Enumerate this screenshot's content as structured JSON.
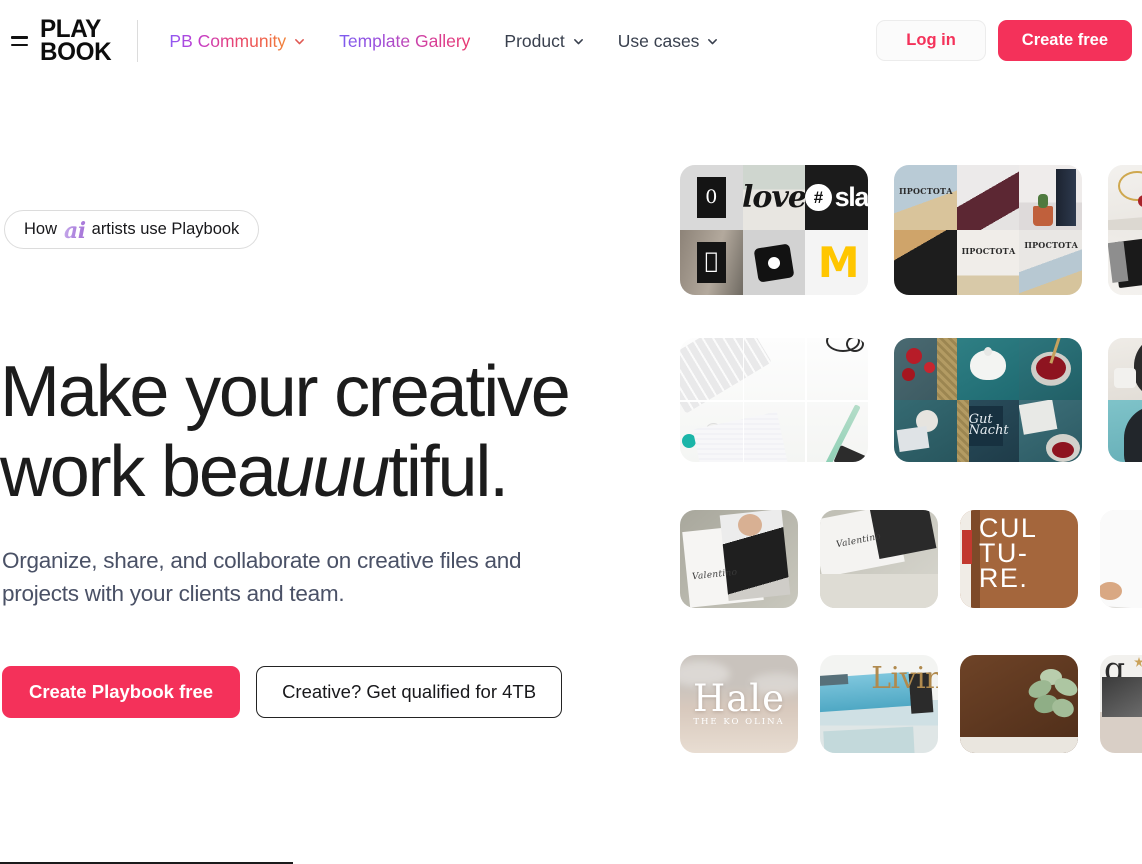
{
  "header": {
    "menu_icon": "hamburger-icon",
    "logo": {
      "line1": "PLAY",
      "line2": "BOOK"
    },
    "nav": [
      {
        "label": "PB Community",
        "style": "gradient-community",
        "has_chevron": true
      },
      {
        "label": "Template Gallery",
        "style": "gradient-template",
        "has_chevron": false
      },
      {
        "label": "Product",
        "style": "plain",
        "has_chevron": true
      },
      {
        "label": "Use cases",
        "style": "plain",
        "has_chevron": true
      }
    ],
    "login_label": "Log in",
    "create_free_label": "Create free"
  },
  "hero": {
    "badge": {
      "before": "How",
      "highlight": "ai",
      "after": "artists use Playbook"
    },
    "headline": {
      "part1": "Make your creative work bea",
      "italic": "uuu",
      "part2": "tiful."
    },
    "subhead": "Organize, share, and collaborate on creative files and projects with your clients and team.",
    "primary_cta": "Create Playbook free",
    "secondary_cta": "Creative? Get qualified for 4TB"
  },
  "gallery": {
    "rows": [
      {
        "cards": [
          {
            "name": "brand-logo-collage",
            "caption_tiles": [
              "0",
              "love",
              "#slack",
              "apple",
              "camera",
              "mcdonalds"
            ]
          },
          {
            "name": "book-covers-collage",
            "caption_tiles": [
              "ПРОСТОТА",
              "book",
              "cactus",
              "black book",
              "ПРОСТОТА",
              "ПРОСТОТА"
            ]
          },
          {
            "name": "jewelry-notebook-collage",
            "caption_tiles": [
              "jewelry",
              "notebook"
            ]
          }
        ]
      },
      {
        "cards": [
          {
            "name": "white-desk-flatlay",
            "caption_tiles": [
              "keyboard",
              "glasses",
              "notebook",
              "pencil"
            ]
          },
          {
            "name": "teal-food-collage",
            "caption_tiles": [
              "cherries",
              "teapot",
              "bowl",
              "coffee",
              "lettering",
              "berries"
            ]
          },
          {
            "name": "portrait-collage",
            "caption_tiles": [
              "woman coffee",
              "woman hoodie"
            ]
          }
        ]
      },
      {
        "cards": [
          {
            "name": "magazine-spread-valentino",
            "caption": "Valentino"
          },
          {
            "name": "magazine-closed-valentino",
            "caption": "Valentino"
          },
          {
            "name": "culture-book-cover",
            "caption": "CULTURE"
          },
          {
            "name": "hand-holding-book",
            "caption": ""
          }
        ]
      },
      {
        "cards": [
          {
            "name": "hale-ko-olina-cover",
            "caption": "Hale",
            "subcaption": "THE KO OLINA"
          },
          {
            "name": "living-magazine",
            "caption": "Livin"
          },
          {
            "name": "wood-succulent-photo",
            "caption": ""
          },
          {
            "name": "magazine-g-spread",
            "caption": "g"
          }
        ]
      }
    ]
  },
  "colors": {
    "accent_pink": "#F4315A",
    "gradient_purple": "#8B5CF6",
    "gradient_orange": "#F1863A",
    "text_dark": "#1C1C1C",
    "text_muted": "#4A5166"
  }
}
